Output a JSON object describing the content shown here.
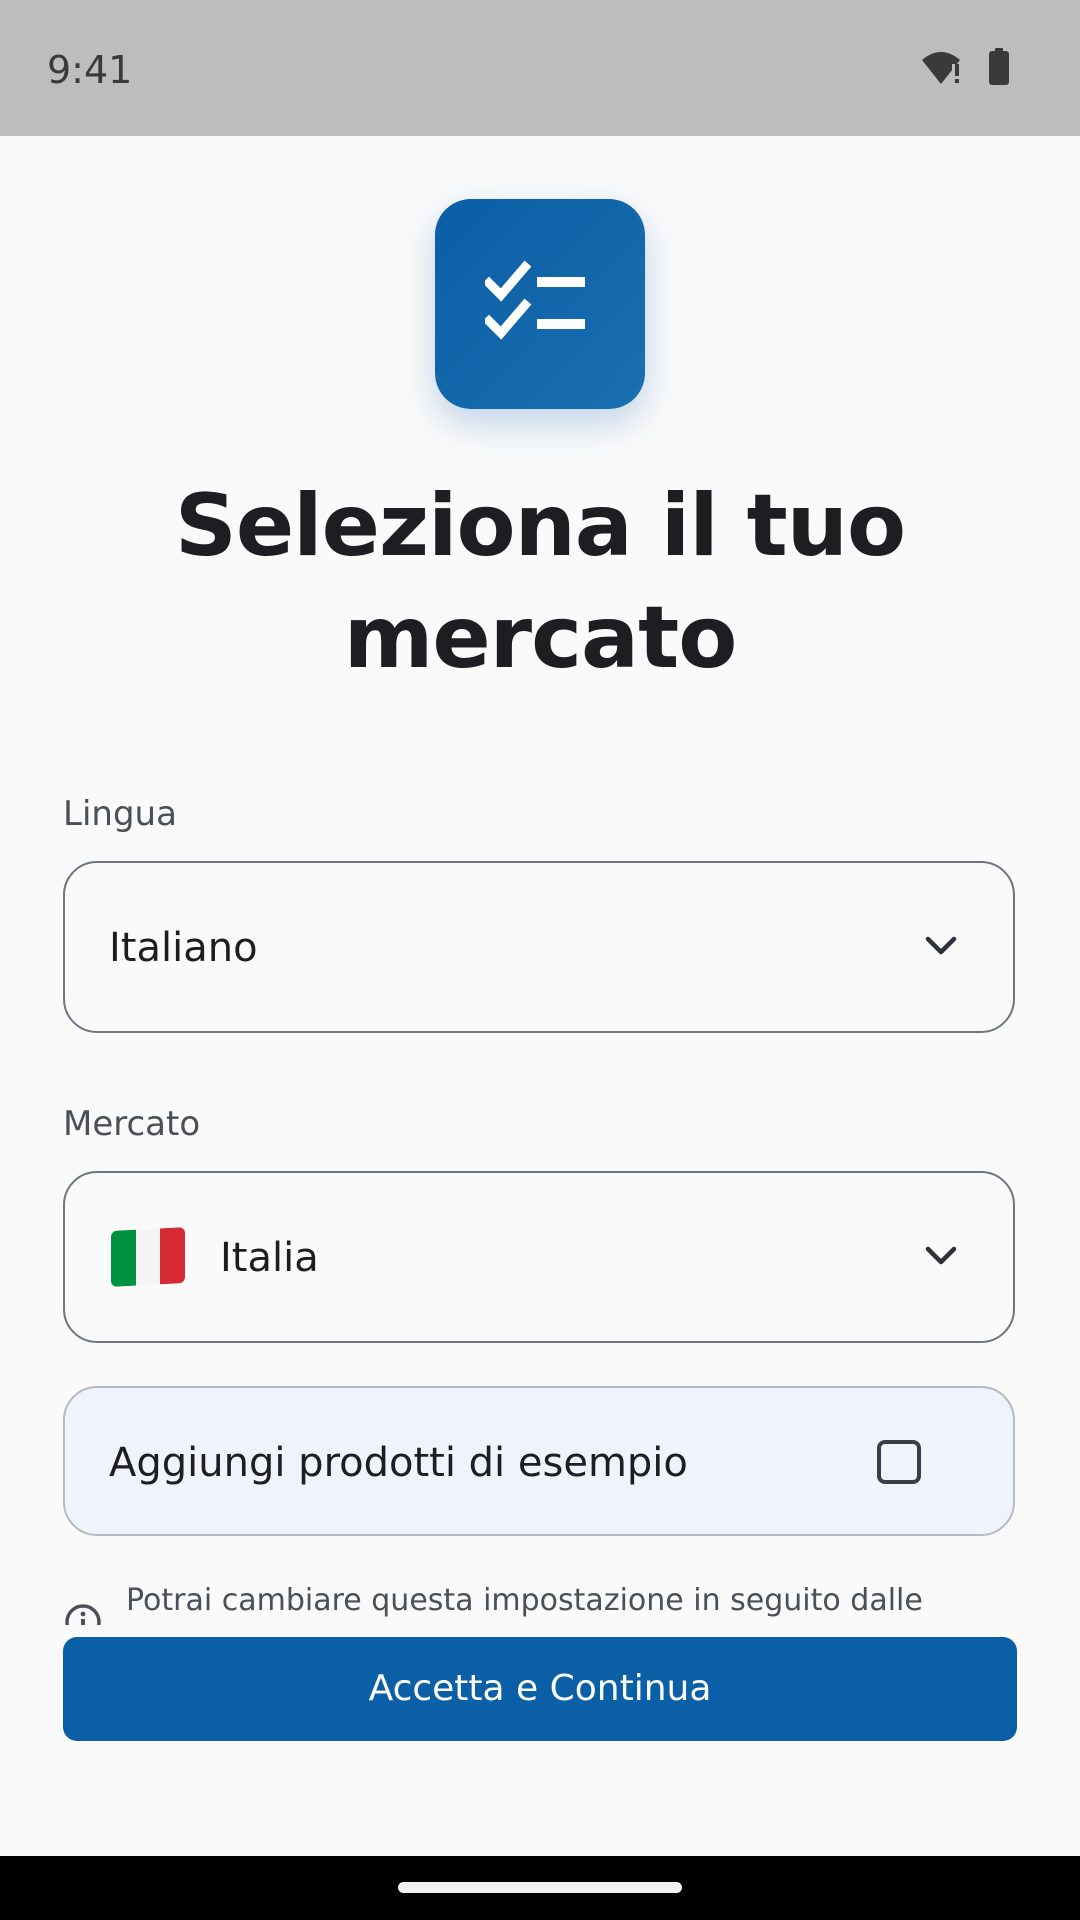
{
  "status_bar": {
    "time": "9:41"
  },
  "icons": {
    "app_logo": "checklist-icon",
    "wifi": "wifi-icon",
    "battery": "battery-icon",
    "chevron": "chevron-down-icon",
    "info": "info-icon",
    "flag": "italy-flag-icon"
  },
  "header": {
    "title_line1": "Seleziona il tuo",
    "title_line2": "mercato"
  },
  "language_field": {
    "label": "Lingua",
    "value": "Italiano"
  },
  "market_field": {
    "label": "Mercato",
    "value": "Italia"
  },
  "sample_products": {
    "label": "Aggiungi prodotti di esempio",
    "checked": false
  },
  "info_note": {
    "text": "Potrai cambiare questa impostazione in seguito dalle"
  },
  "primary_action": {
    "label": "Accetta e Continua"
  },
  "colors": {
    "accent": "#0A5FA6",
    "card_background": "#EFF3FC",
    "status_bar": "#BDBDBD"
  }
}
